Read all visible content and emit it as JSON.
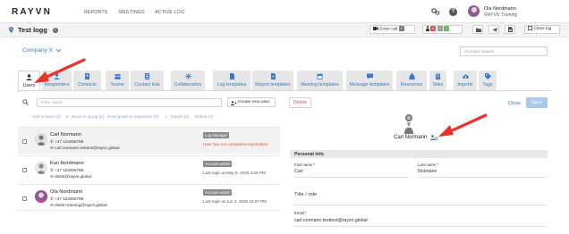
{
  "topnav": {
    "logo": "RAYVN",
    "links": [
      "REPORTS",
      "MEETINGS",
      "ACTIVE LOG"
    ],
    "user_name": "Ola Nordmann",
    "user_org": "RAYVN Training"
  },
  "page": {
    "title": "Test logg",
    "enter_call": "Enter call",
    "enter_call_count": "0",
    "participants": {
      "red": "4",
      "gray": "1",
      "green": "1"
    },
    "close_log": "Close log"
  },
  "company": {
    "selector": "Company X",
    "account_search_placeholder": "Account search"
  },
  "tabs": [
    {
      "label": "Users",
      "icon": "user-icon"
    },
    {
      "label": "Responders",
      "icon": "responder-icon"
    },
    {
      "label": "Contacts",
      "icon": "contacts-icon"
    },
    {
      "label": "Teams",
      "icon": "teams-icon"
    },
    {
      "label": "Contact lists",
      "icon": "contact-lists-icon"
    },
    {
      "label": "Collaboration",
      "icon": "collaboration-icon"
    },
    {
      "label": "Log templates",
      "icon": "log-templates-icon"
    },
    {
      "label": "Report templates",
      "icon": "report-templates-icon"
    },
    {
      "label": "Meeting templates",
      "icon": "meeting-templates-icon"
    },
    {
      "label": "Message templates",
      "icon": "message-templates-icon"
    },
    {
      "label": "Resources",
      "icon": "resources-icon"
    },
    {
      "label": "Sites",
      "icon": "sites-icon"
    },
    {
      "label": "Imports",
      "icon": "imports-icon"
    },
    {
      "label": "Tags",
      "icon": "tags-icon"
    }
  ],
  "list": {
    "filter_placeholder": "Filter users",
    "create_button": "Create new user",
    "actions": [
      "Add to team (0)",
      "Move to group (0)",
      "Downgrade to responder (0)",
      "Export (0)",
      "Delete (0)"
    ],
    "users": [
      {
        "name": "Carl Normann",
        "phone": "+47 123456789",
        "email": "carl.normann.testtest@rayvn.global",
        "badge": "Log Manager",
        "status": "User has not completed registration"
      },
      {
        "name": "Kari Nordmann",
        "phone": "+47 123456789",
        "email": "dotnk@rayvn.global",
        "badge": "Account admin",
        "status": "Last login at May 8, 2025 2:59 PM"
      },
      {
        "name": "Ola Nordmann",
        "phone": "+47 123456789",
        "email": "dotnk+training@rayvn.global",
        "badge": "Account admin",
        "status": "Last login at Jun 2, 2025 10:27 PM"
      }
    ]
  },
  "detail": {
    "delete": "Delete",
    "close": "Close",
    "save": "Save",
    "name": "Carl Normann",
    "section": "Personal info",
    "first_name_label": "First name *",
    "first_name": "Carl",
    "last_name_label": "Last name *",
    "last_name": "Normann",
    "title_label": "Title / role",
    "email_label": "Email *",
    "email": "carl.normann.testtest@rayvn.global"
  },
  "colors": {
    "accent": "#3a7ac8",
    "danger": "#d9534f",
    "annotation_arrow": "#e8322b",
    "save_disabled": "#a9c8ea"
  }
}
